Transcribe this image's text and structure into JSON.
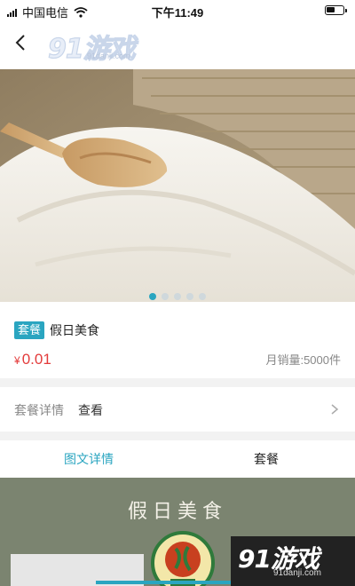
{
  "status_bar": {
    "carrier": "中国电信",
    "time": "下午11:49"
  },
  "nav": {
    "back_icon": "chevron-left-icon",
    "logo_text": "91游戏",
    "logo_sub": "91danji.com"
  },
  "banner": {
    "image": "rice-bag-with-wooden-scoop",
    "dots_total": 5,
    "dots_active": 0
  },
  "product": {
    "tag": "套餐",
    "title": "假日美食",
    "currency": "¥",
    "price": "0.01",
    "sales": "月销量:5000件"
  },
  "detail": {
    "label": "套餐详情",
    "link": "查看"
  },
  "tabs": [
    {
      "label": "图文详情",
      "active": true
    },
    {
      "label": "套餐",
      "active": false
    }
  ],
  "content": {
    "title": "假日美食"
  },
  "watermark": {
    "text": "91游戏",
    "sub": "91danji.com"
  },
  "colors": {
    "accent": "#2aa5c0",
    "price": "#e33b3b",
    "content_bg": "#7b8470"
  }
}
